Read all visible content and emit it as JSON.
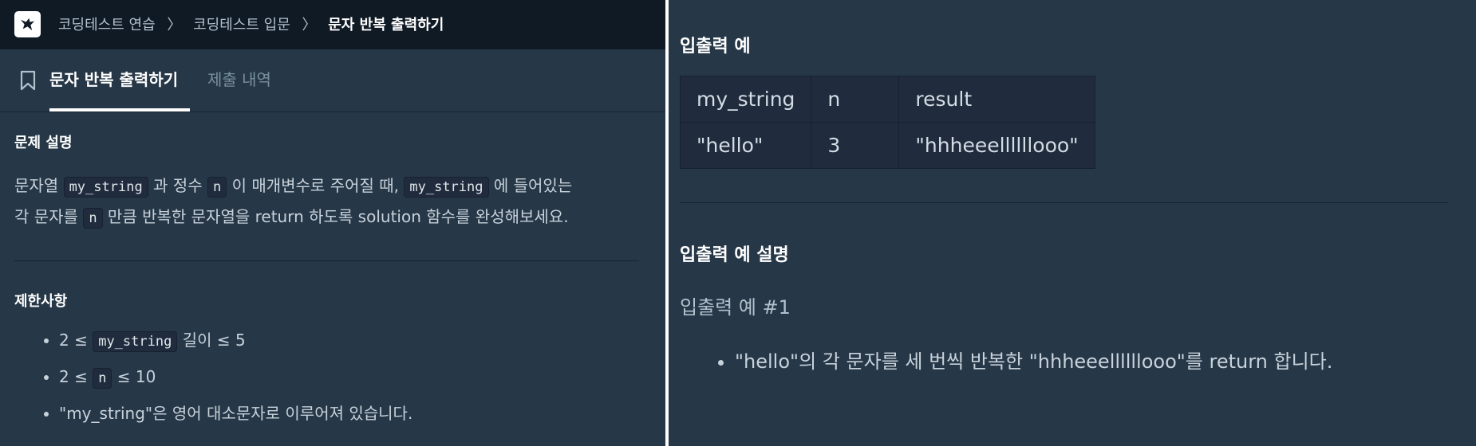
{
  "breadcrumb": {
    "items": [
      "코딩테스트 연습",
      "코딩테스트 입문"
    ],
    "current": "문자 반복 출력하기",
    "separator": "〉"
  },
  "tabs": {
    "active": "문자 반복 출력하기",
    "inactive": "제출 내역"
  },
  "description": {
    "title": "문제 설명",
    "line1": [
      "문자열 ",
      "my_string",
      " 과 정수 ",
      "n",
      " 이 매개변수로 주어질 때, ",
      "my_string",
      " 에 들어있는"
    ],
    "line2": [
      "각 문자를 ",
      "n",
      " 만큼 반복한 문자열을 return 하도록 solution 함수를 완성해보세요."
    ]
  },
  "constraints": {
    "title": "제한사항",
    "items": [
      [
        "2 ≤ ",
        "my_string",
        " 길이 ≤ 5"
      ],
      [
        "2 ≤ ",
        "n",
        " ≤ 10"
      ],
      [
        "\"my_string\"은 영어 대소문자로 이루어져 있습니다."
      ]
    ]
  },
  "examples": {
    "title": "입출력 예",
    "headers": [
      "my_string",
      "n",
      "result"
    ],
    "rows": [
      [
        "\"hello\"",
        "3",
        "\"hhheeellllllooo\""
      ]
    ]
  },
  "explanation": {
    "title": "입출력 예 설명",
    "subtitle": "입출력 예 #1",
    "items": [
      "\"hello\"의 각 문자를 세 번씩 반복한 \"hhheeellllllooo\"를 return 합니다."
    ]
  }
}
